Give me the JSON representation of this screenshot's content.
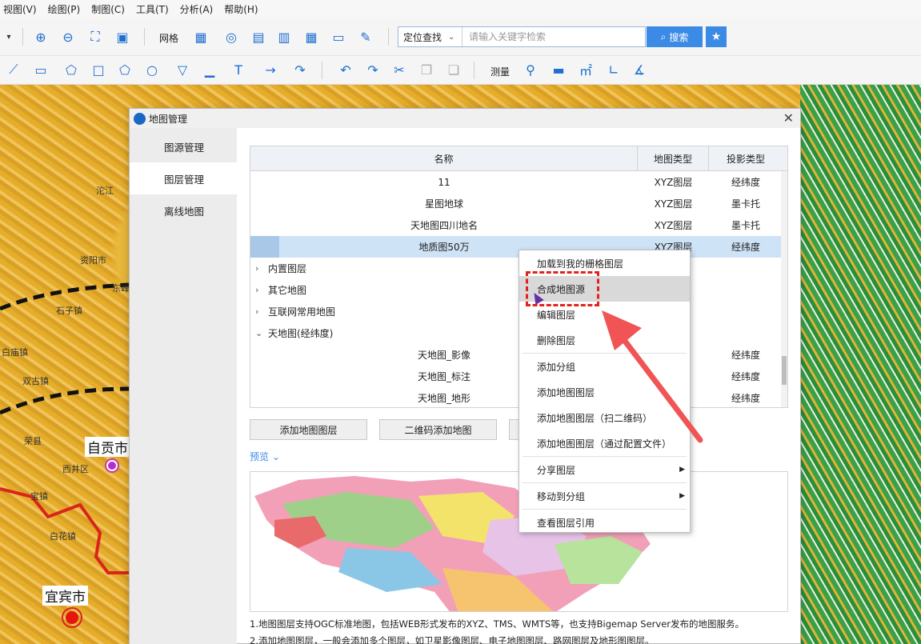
{
  "menu": [
    "视图(V)",
    "绘图(P)",
    "制图(C)",
    "工具(T)",
    "分析(A)",
    "帮助(H)"
  ],
  "toolbar": {
    "grid_label": "网格",
    "measure_label": "测量"
  },
  "search": {
    "scope": "定位查找",
    "placeholder": "请输入关键字检索",
    "button": "搜索"
  },
  "map": {
    "labels": [
      "资阳市",
      "荣县",
      "西井区",
      "白花镇",
      "宝镇",
      "白庙镇",
      "双古镇",
      "石子镇",
      "东峰",
      "沱江"
    ],
    "cities": [
      "自贡市",
      "宜宾市"
    ],
    "accent_route": "#e0241b"
  },
  "dialog": {
    "title": "地图管理",
    "sidebar": [
      "图源管理",
      "图层管理",
      "离线地图"
    ],
    "columns": [
      "名称",
      "地图类型",
      "投影类型"
    ],
    "rows": [
      {
        "name": "11",
        "type": "XYZ图层",
        "proj": "经纬度"
      },
      {
        "name": "星图地球",
        "type": "XYZ图层",
        "proj": "墨卡托"
      },
      {
        "name": "天地图四川地名",
        "type": "XYZ图层",
        "proj": "墨卡托"
      },
      {
        "name": "地质图50万",
        "type": "XYZ图层",
        "proj": "经纬度"
      }
    ],
    "groups": [
      {
        "name": "内置图层",
        "expanded": false
      },
      {
        "name": "其它地图",
        "expanded": false
      },
      {
        "name": "互联网常用地图",
        "expanded": false
      },
      {
        "name": "天地图(经纬度)",
        "expanded": true
      }
    ],
    "subrows": [
      {
        "name": "天地图_影像",
        "proj": "经纬度"
      },
      {
        "name": "天地图_标注",
        "proj": "经纬度"
      },
      {
        "name": "天地图_地形",
        "proj": "经纬度"
      }
    ],
    "buttons": [
      "添加地图图层",
      "二维码添加地图"
    ],
    "preview": "预览",
    "notes": [
      "1.地图图层支持OGC标准地图，包括WEB形式发布的XYZ、TMS、WMTS等，也支持Bigemap Server发布的地图服务。",
      "2.添加地图图层，一般会添加多个图层，如卫星影像图层、电子地图图层、路网图层及地形图图层。"
    ]
  },
  "context_menu": [
    {
      "label": "加载到我的栅格图层"
    },
    {
      "label": "合成地图源",
      "highlight": true
    },
    {
      "label": "编辑图层"
    },
    {
      "label": "删除图层"
    },
    {
      "label": "添加分组"
    },
    {
      "label": "添加地图图层"
    },
    {
      "label": "添加地图图层（扫二维码）"
    },
    {
      "label": "添加地图图层（通过配置文件）"
    },
    {
      "label": "分享图层",
      "submenu": true
    },
    {
      "label": "移动到分组",
      "submenu": true
    },
    {
      "label": "查看图层引用"
    }
  ]
}
